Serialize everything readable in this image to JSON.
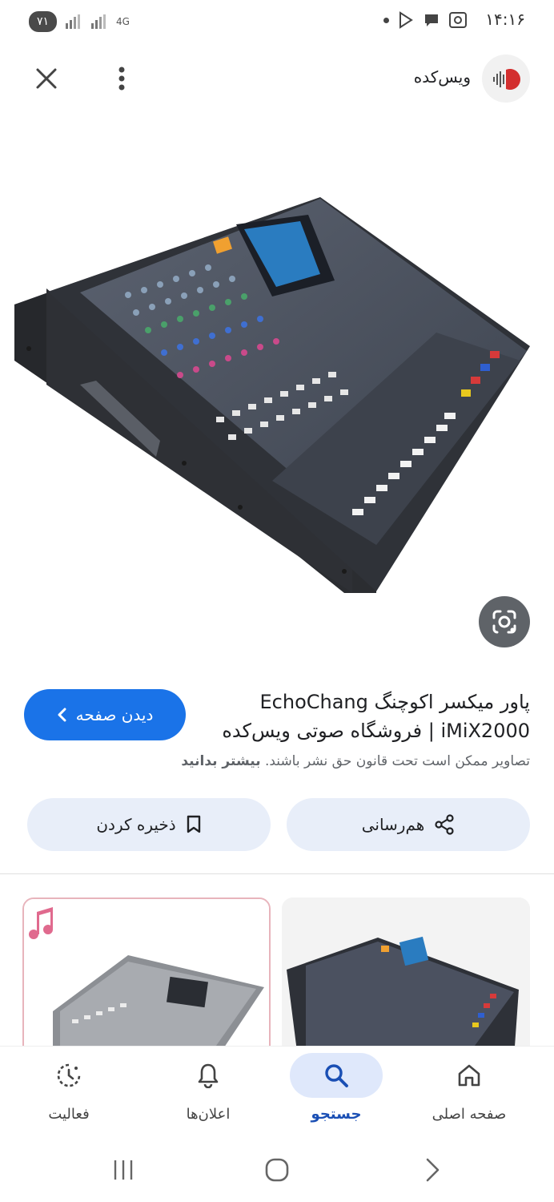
{
  "status_bar": {
    "time": "۱۴:۱۶",
    "battery": "۷۱",
    "network": "4G"
  },
  "header": {
    "site_name": "ویس‌کده",
    "icons": [
      "close-icon",
      "more-vert-icon",
      "site-logo"
    ]
  },
  "result": {
    "title_line1": "پاور میکسر اکوچنگ EchoChang",
    "title_line2": "iMiX2000 | فروشگاه صوتی ویس‌کده",
    "visit_label": "دیدن صفحه",
    "copyright_text": "تصاویر ممکن است تحت قانون حق نشر باشند.",
    "learn_more": "بیشتر بدانید",
    "share_label": "هم‌رسانی",
    "save_label": "ذخیره کردن"
  },
  "bottom_nav": {
    "items": [
      {
        "label": "صفحه اصلی",
        "icon": "home-icon"
      },
      {
        "label": "جستجو",
        "icon": "search-icon"
      },
      {
        "label": "اعلان‌ها",
        "icon": "bell-icon"
      },
      {
        "label": "فعالیت",
        "icon": "activity-icon"
      }
    ]
  },
  "colors": {
    "accent": "#1a73e8",
    "button_bg": "#e8eef9",
    "active_nav_bg": "#dfe8fb"
  }
}
